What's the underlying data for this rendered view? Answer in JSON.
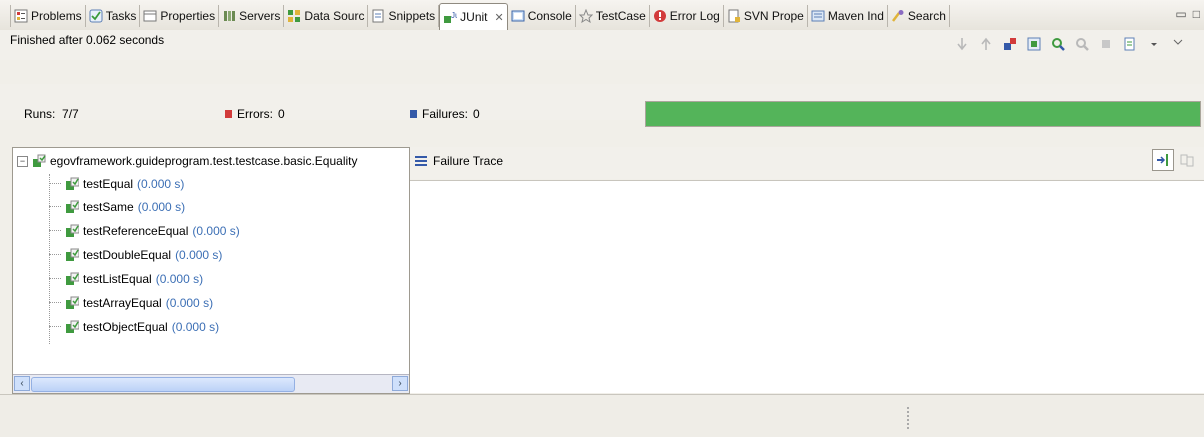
{
  "tabs": [
    {
      "label": "Problems",
      "icon": "problems-icon"
    },
    {
      "label": "Tasks",
      "icon": "tasks-icon"
    },
    {
      "label": "Properties",
      "icon": "properties-icon"
    },
    {
      "label": "Servers",
      "icon": "servers-icon"
    },
    {
      "label": "Data Sourc",
      "icon": "data-source-icon"
    },
    {
      "label": "Snippets",
      "icon": "snippets-icon"
    },
    {
      "label": "JUnit",
      "icon": "junit-icon",
      "active": true
    },
    {
      "label": "Console",
      "icon": "console-icon"
    },
    {
      "label": "TestCase",
      "icon": "testcase-icon"
    },
    {
      "label": "Error Log",
      "icon": "error-log-icon"
    },
    {
      "label": "SVN Prope",
      "icon": "svn-properties-icon"
    },
    {
      "label": "Maven Ind",
      "icon": "maven-index-icon"
    },
    {
      "label": "Search",
      "icon": "search-icon"
    }
  ],
  "status": {
    "text": "Finished after 0.062 seconds"
  },
  "counters": {
    "runs_label": "Runs:",
    "runs_value": "7/7",
    "errors_label": "Errors:",
    "errors_value": "0",
    "failures_label": "Failures:",
    "failures_value": "0"
  },
  "progress": {
    "fraction": 1.0,
    "color": "#54b45a"
  },
  "tree": {
    "root": "egovframework.guideprogram.test.testcase.basic.Equality",
    "items": [
      {
        "name": "testEqual",
        "time": "(0.000 s)"
      },
      {
        "name": "testSame",
        "time": "(0.000 s)"
      },
      {
        "name": "testReferenceEqual",
        "time": "(0.000 s)"
      },
      {
        "name": "testDoubleEqual",
        "time": "(0.000 s)"
      },
      {
        "name": "testListEqual",
        "time": "(0.000 s)"
      },
      {
        "name": "testArrayEqual",
        "time": "(0.000 s)"
      },
      {
        "name": "testObjectEqual",
        "time": "(0.000 s)"
      }
    ]
  },
  "trace": {
    "title": "Failure Trace"
  },
  "colors": {
    "error": "#d23b3b",
    "failure": "#3459a8",
    "time": "#3c6fb5",
    "success": "#54b45a"
  }
}
